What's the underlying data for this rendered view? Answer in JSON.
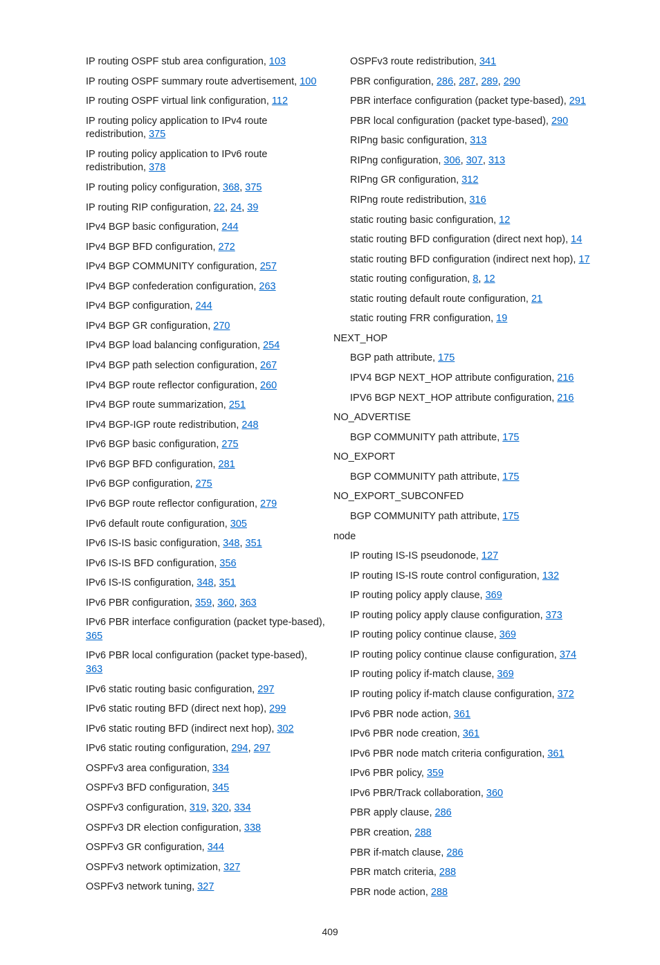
{
  "page_number": "409",
  "left": [
    {
      "indent": 1,
      "text": "IP routing OSPF stub area configuration, ",
      "refs": [
        "103"
      ]
    },
    {
      "indent": 1,
      "text": "IP routing OSPF summary route advertisement, ",
      "refs": [
        "100"
      ]
    },
    {
      "indent": 1,
      "text": "IP routing OSPF virtual link configuration, ",
      "refs": [
        "112"
      ]
    },
    {
      "indent": 1,
      "text": "IP routing policy application to IPv4 route redistribution, ",
      "refs": [
        "375"
      ]
    },
    {
      "indent": 1,
      "text": "IP routing policy application to IPv6 route redistribution, ",
      "refs": [
        "378"
      ]
    },
    {
      "indent": 1,
      "text": "IP routing policy configuration, ",
      "refs": [
        "368",
        "375"
      ]
    },
    {
      "indent": 1,
      "text": "IP routing RIP configuration, ",
      "refs": [
        "22",
        "24",
        "39"
      ]
    },
    {
      "indent": 1,
      "text": "IPv4 BGP basic configuration, ",
      "refs": [
        "244"
      ]
    },
    {
      "indent": 1,
      "text": "IPv4 BGP BFD configuration, ",
      "refs": [
        "272"
      ]
    },
    {
      "indent": 1,
      "text": "IPv4 BGP COMMUNITY configuration, ",
      "refs": [
        "257"
      ]
    },
    {
      "indent": 1,
      "text": "IPv4 BGP confederation configuration, ",
      "refs": [
        "263"
      ]
    },
    {
      "indent": 1,
      "text": "IPv4 BGP configuration, ",
      "refs": [
        "244"
      ]
    },
    {
      "indent": 1,
      "text": "IPv4 BGP GR configuration, ",
      "refs": [
        "270"
      ]
    },
    {
      "indent": 1,
      "text": "IPv4 BGP load balancing configuration, ",
      "refs": [
        "254"
      ]
    },
    {
      "indent": 1,
      "text": "IPv4 BGP path selection configuration, ",
      "refs": [
        "267"
      ]
    },
    {
      "indent": 1,
      "text": "IPv4 BGP route reflector configuration, ",
      "refs": [
        "260"
      ]
    },
    {
      "indent": 1,
      "text": "IPv4 BGP route summarization, ",
      "refs": [
        "251"
      ]
    },
    {
      "indent": 1,
      "text": "IPv4 BGP-IGP route redistribution, ",
      "refs": [
        "248"
      ]
    },
    {
      "indent": 1,
      "text": "IPv6 BGP basic configuration, ",
      "refs": [
        "275"
      ]
    },
    {
      "indent": 1,
      "text": "IPv6 BGP BFD configuration, ",
      "refs": [
        "281"
      ]
    },
    {
      "indent": 1,
      "text": "IPv6 BGP configuration, ",
      "refs": [
        "275"
      ]
    },
    {
      "indent": 1,
      "text": "IPv6 BGP route reflector configuration, ",
      "refs": [
        "279"
      ]
    },
    {
      "indent": 1,
      "text": "IPv6 default route configuration, ",
      "refs": [
        "305"
      ]
    },
    {
      "indent": 1,
      "text": "IPv6 IS-IS basic configuration, ",
      "refs": [
        "348",
        "351"
      ]
    },
    {
      "indent": 1,
      "text": "IPv6 IS-IS BFD configuration, ",
      "refs": [
        "356"
      ]
    },
    {
      "indent": 1,
      "text": "IPv6 IS-IS configuration, ",
      "refs": [
        "348",
        "351"
      ]
    },
    {
      "indent": 1,
      "text": "IPv6 PBR configuration, ",
      "refs": [
        "359",
        "360",
        "363"
      ]
    },
    {
      "indent": 1,
      "text": "IPv6 PBR interface configuration (packet type-based), ",
      "refs": [
        "365"
      ]
    },
    {
      "indent": 1,
      "text": "IPv6 PBR local configuration (packet type-based), ",
      "refs": [
        "363"
      ]
    },
    {
      "indent": 1,
      "text": "IPv6 static routing basic configuration, ",
      "refs": [
        "297"
      ]
    },
    {
      "indent": 1,
      "text": "IPv6 static routing BFD (direct next hop), ",
      "refs": [
        "299"
      ]
    },
    {
      "indent": 1,
      "text": "IPv6 static routing BFD (indirect next hop), ",
      "refs": [
        "302"
      ]
    },
    {
      "indent": 1,
      "text": "IPv6 static routing configuration, ",
      "refs": [
        "294",
        "297"
      ]
    },
    {
      "indent": 1,
      "text": "OSPFv3 area configuration, ",
      "refs": [
        "334"
      ]
    },
    {
      "indent": 1,
      "text": "OSPFv3 BFD configuration, ",
      "refs": [
        "345"
      ]
    },
    {
      "indent": 1,
      "text": "OSPFv3 configuration, ",
      "refs": [
        "319",
        "320",
        "334"
      ]
    },
    {
      "indent": 1,
      "text": "OSPFv3 DR election configuration, ",
      "refs": [
        "338"
      ]
    },
    {
      "indent": 1,
      "text": "OSPFv3 GR configuration, ",
      "refs": [
        "344"
      ]
    },
    {
      "indent": 1,
      "text": "OSPFv3 network optimization, ",
      "refs": [
        "327"
      ]
    },
    {
      "indent": 1,
      "text": "OSPFv3 network tuning, ",
      "refs": [
        "327"
      ]
    }
  ],
  "right": [
    {
      "indent": 1,
      "text": "OSPFv3 route redistribution, ",
      "refs": [
        "341"
      ]
    },
    {
      "indent": 1,
      "text": "PBR configuration, ",
      "refs": [
        "286",
        "287",
        "289",
        "290"
      ]
    },
    {
      "indent": 1,
      "text": "PBR interface configuration (packet type-based), ",
      "refs": [
        "291"
      ]
    },
    {
      "indent": 1,
      "text": "PBR local configuration (packet type-based), ",
      "refs": [
        "290"
      ]
    },
    {
      "indent": 1,
      "text": "RIPng basic configuration, ",
      "refs": [
        "313"
      ]
    },
    {
      "indent": 1,
      "text": "RIPng configuration, ",
      "refs": [
        "306",
        "307",
        "313"
      ]
    },
    {
      "indent": 1,
      "text": "RIPng GR configuration, ",
      "refs": [
        "312"
      ]
    },
    {
      "indent": 1,
      "text": "RIPng route redistribution, ",
      "refs": [
        "316"
      ]
    },
    {
      "indent": 1,
      "text": "static routing basic configuration, ",
      "refs": [
        "12"
      ]
    },
    {
      "indent": 1,
      "text": "static routing BFD configuration (direct next hop), ",
      "refs": [
        "14"
      ]
    },
    {
      "indent": 1,
      "text": "static routing BFD configuration (indirect next hop), ",
      "refs": [
        "17"
      ]
    },
    {
      "indent": 1,
      "text": "static routing configuration, ",
      "refs": [
        "8",
        "12"
      ]
    },
    {
      "indent": 1,
      "text": "static routing default route configuration, ",
      "refs": [
        "21"
      ]
    },
    {
      "indent": 1,
      "text": "static routing FRR configuration, ",
      "refs": [
        "19"
      ]
    },
    {
      "heading": "NEXT_HOP"
    },
    {
      "indent": 1,
      "text": "BGP path attribute, ",
      "refs": [
        "175"
      ]
    },
    {
      "indent": 1,
      "text": "IPV4 BGP NEXT_HOP attribute configuration, ",
      "refs": [
        "216"
      ]
    },
    {
      "indent": 1,
      "text": "IPV6 BGP NEXT_HOP attribute configuration, ",
      "refs": [
        "216"
      ]
    },
    {
      "heading": "NO_ADVERTISE"
    },
    {
      "indent": 1,
      "text": "BGP COMMUNITY path attribute, ",
      "refs": [
        "175"
      ]
    },
    {
      "heading": "NO_EXPORT"
    },
    {
      "indent": 1,
      "text": "BGP COMMUNITY path attribute, ",
      "refs": [
        "175"
      ]
    },
    {
      "heading": "NO_EXPORT_SUBCONFED"
    },
    {
      "indent": 1,
      "text": "BGP COMMUNITY path attribute, ",
      "refs": [
        "175"
      ]
    },
    {
      "heading": "node"
    },
    {
      "indent": 1,
      "text": "IP routing IS-IS pseudonode, ",
      "refs": [
        "127"
      ]
    },
    {
      "indent": 1,
      "text": "IP routing IS-IS route control configuration, ",
      "refs": [
        "132"
      ]
    },
    {
      "indent": 1,
      "text": "IP routing policy apply clause, ",
      "refs": [
        "369"
      ]
    },
    {
      "indent": 1,
      "text": "IP routing policy apply clause configuration, ",
      "refs": [
        "373"
      ]
    },
    {
      "indent": 1,
      "text": "IP routing policy continue clause, ",
      "refs": [
        "369"
      ]
    },
    {
      "indent": 1,
      "text": "IP routing policy continue clause configuration, ",
      "refs": [
        "374"
      ]
    },
    {
      "indent": 1,
      "text": "IP routing policy if-match clause, ",
      "refs": [
        "369"
      ]
    },
    {
      "indent": 1,
      "text": "IP routing policy if-match clause configuration, ",
      "refs": [
        "372"
      ]
    },
    {
      "indent": 1,
      "text": "IPv6 PBR node action, ",
      "refs": [
        "361"
      ]
    },
    {
      "indent": 1,
      "text": "IPv6 PBR node creation, ",
      "refs": [
        "361"
      ]
    },
    {
      "indent": 1,
      "text": "IPv6 PBR node match criteria configuration, ",
      "refs": [
        "361"
      ]
    },
    {
      "indent": 1,
      "text": "IPv6 PBR policy, ",
      "refs": [
        "359"
      ]
    },
    {
      "indent": 1,
      "text": "IPv6 PBR/Track collaboration, ",
      "refs": [
        "360"
      ]
    },
    {
      "indent": 1,
      "text": "PBR apply clause, ",
      "refs": [
        "286"
      ]
    },
    {
      "indent": 1,
      "text": "PBR creation, ",
      "refs": [
        "288"
      ]
    },
    {
      "indent": 1,
      "text": "PBR if-match clause, ",
      "refs": [
        "286"
      ]
    },
    {
      "indent": 1,
      "text": "PBR match criteria, ",
      "refs": [
        "288"
      ]
    },
    {
      "indent": 1,
      "text": "PBR node action, ",
      "refs": [
        "288"
      ]
    }
  ]
}
